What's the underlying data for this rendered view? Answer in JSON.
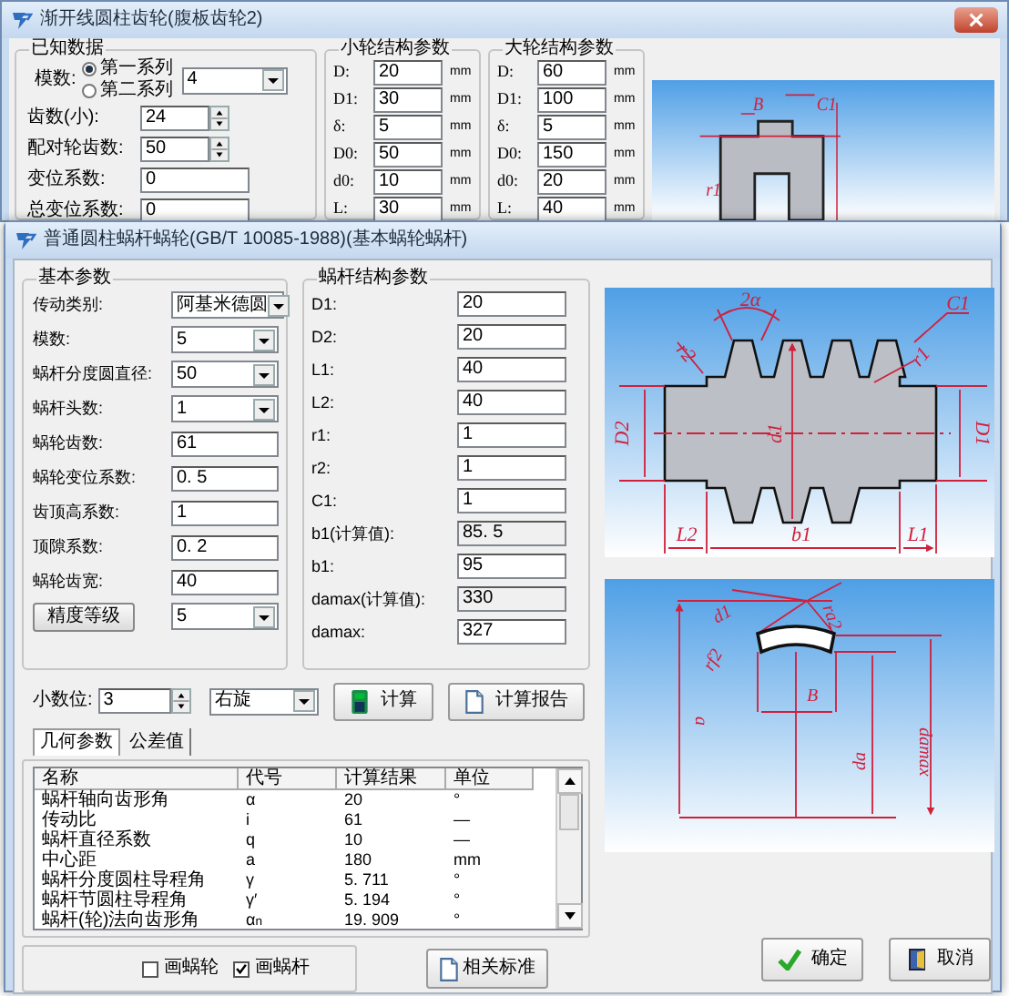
{
  "back_window": {
    "title": "渐开线圆柱齿轮(腹板齿轮2)",
    "known_data": {
      "title": "已知数据",
      "module_label": "模数:",
      "series": [
        {
          "label": "第一系列",
          "selected": true
        },
        {
          "label": "第二系列",
          "selected": false
        }
      ],
      "module_value": "4",
      "fields": [
        {
          "label": "齿数(小):",
          "value": "24",
          "kind": "spinner"
        },
        {
          "label": "配对轮齿数:",
          "value": "50",
          "kind": "spinner"
        },
        {
          "label": "变位系数:",
          "value": "0",
          "kind": "text"
        },
        {
          "label": "总变位系数:",
          "value": "0",
          "kind": "text"
        }
      ]
    },
    "small_wheel": {
      "title": "小轮结构参数",
      "params": [
        {
          "label": "D:",
          "value": "20",
          "unit": "mm"
        },
        {
          "label": "D1:",
          "value": "30",
          "unit": "mm"
        },
        {
          "label": "δ:",
          "value": "5",
          "unit": "mm"
        },
        {
          "label": "D0:",
          "value": "50",
          "unit": "mm"
        },
        {
          "label": "d0:",
          "value": "10",
          "unit": "mm"
        },
        {
          "label": "L:",
          "value": "30",
          "unit": "mm"
        }
      ]
    },
    "large_wheel": {
      "title": "大轮结构参数",
      "params": [
        {
          "label": "D:",
          "value": "60",
          "unit": "mm"
        },
        {
          "label": "D1:",
          "value": "100",
          "unit": "mm"
        },
        {
          "label": "δ:",
          "value": "5",
          "unit": "mm"
        },
        {
          "label": "D0:",
          "value": "150",
          "unit": "mm"
        },
        {
          "label": "d0:",
          "value": "20",
          "unit": "mm"
        },
        {
          "label": "L:",
          "value": "40",
          "unit": "mm"
        }
      ]
    },
    "gear_drawing": {
      "labels": [
        "B",
        "C1",
        "r1"
      ]
    }
  },
  "front_window": {
    "title": "普通圆柱蜗杆蜗轮(GB/T 10085-1988)(基本蜗轮蜗杆)",
    "basic_params": {
      "title": "基本参数",
      "fields": [
        {
          "label": "传动类别:",
          "value": "阿基米德圆",
          "kind": "dropdown"
        },
        {
          "label": "模数:",
          "value": "5",
          "kind": "dropdown"
        },
        {
          "label": "蜗杆分度圆直径:",
          "value": "50",
          "kind": "dropdown"
        },
        {
          "label": "蜗杆头数:",
          "value": "1",
          "kind": "dropdown"
        },
        {
          "label": "蜗轮齿数:",
          "value": "61",
          "kind": "text"
        },
        {
          "label": "蜗轮变位系数:",
          "value": "0. 5",
          "kind": "text"
        },
        {
          "label": "齿顶高系数:",
          "value": "1",
          "kind": "text"
        },
        {
          "label": "顶隙系数:",
          "value": "0. 2",
          "kind": "text"
        },
        {
          "label": "蜗轮齿宽:",
          "value": "40",
          "kind": "text"
        },
        {
          "label": "精度等级",
          "value": "5",
          "kind": "button-dropdown"
        }
      ]
    },
    "worm_params": {
      "title": "蜗杆结构参数",
      "fields": [
        {
          "label": "D1:",
          "value": "20",
          "readonly": false
        },
        {
          "label": "D2:",
          "value": "20",
          "readonly": false
        },
        {
          "label": "L1:",
          "value": "40",
          "readonly": false
        },
        {
          "label": "L2:",
          "value": "40",
          "readonly": false
        },
        {
          "label": "r1:",
          "value": "1",
          "readonly": false
        },
        {
          "label": "r2:",
          "value": "1",
          "readonly": false
        },
        {
          "label": "C1:",
          "value": "1",
          "readonly": false
        },
        {
          "label": "b1(计算值):",
          "value": "85. 5",
          "readonly": true
        },
        {
          "label": "b1:",
          "value": "95",
          "readonly": false
        },
        {
          "label": "damax(计算值):",
          "value": "330",
          "readonly": true
        },
        {
          "label": "damax:",
          "value": "327",
          "readonly": false
        }
      ]
    },
    "decimals": {
      "label": "小数位:",
      "value": "3"
    },
    "direction": "右旋",
    "buttons": [
      {
        "label": "计算",
        "kind": "calculate"
      },
      {
        "label": "计算报告",
        "kind": "report"
      }
    ],
    "tabs": [
      {
        "label": "几何参数",
        "selected": true
      },
      {
        "label": "公差值",
        "selected": false
      }
    ],
    "table": {
      "columns": [
        "名称",
        "代号",
        "计算结果",
        "单位"
      ],
      "rows": [
        [
          "蜗杆轴向齿形角",
          "α",
          "20",
          "°"
        ],
        [
          "传动比",
          "i",
          "61",
          "—"
        ],
        [
          "蜗杆直径系数",
          "q",
          "10",
          "—"
        ],
        [
          "中心距",
          "a",
          "180",
          "mm"
        ],
        [
          "蜗杆分度圆柱导程角",
          "γ",
          "5. 711",
          "°"
        ],
        [
          "蜗杆节圆柱导程角",
          "γ′",
          "5. 194",
          "°"
        ],
        [
          "蜗杆(轮)法向齿形角",
          "α$_{n}$",
          "19. 909",
          "°"
        ]
      ]
    },
    "checkboxes": [
      {
        "label": "画蜗轮",
        "checked": false
      },
      {
        "label": "画蜗杆",
        "checked": true
      }
    ],
    "standards_button": "相关标准",
    "ok_button": "确定",
    "cancel_button": "取消",
    "worm_drawing": {
      "labels": [
        "2α",
        "C1",
        "r2",
        "r1",
        "D2",
        "d1",
        "D1",
        "L2",
        "b1",
        "L1"
      ]
    },
    "wheel_drawing": {
      "labels": [
        "d1",
        "ra2",
        "rf2",
        "a",
        "B",
        "da",
        "damax"
      ]
    }
  }
}
